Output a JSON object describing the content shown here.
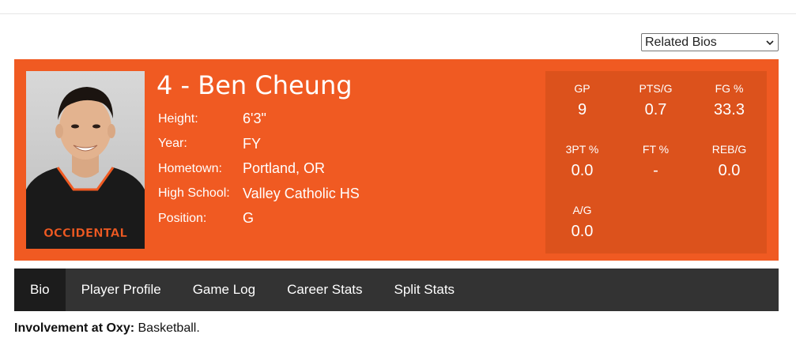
{
  "related_bios": {
    "selected": "Related Bios"
  },
  "player": {
    "title": "4 - Ben Cheung",
    "facts": [
      {
        "label": "Height:",
        "value": "6'3\""
      },
      {
        "label": "Year:",
        "value": "FY"
      },
      {
        "label": "Hometown:",
        "value": "Portland, OR"
      },
      {
        "label": "High School:",
        "value": "Valley Catholic HS"
      },
      {
        "label": "Position:",
        "value": "G"
      }
    ],
    "jersey_text": "OCCIDENTAL"
  },
  "stats": [
    {
      "label": "GP",
      "value": "9"
    },
    {
      "label": "PTS/G",
      "value": "0.7"
    },
    {
      "label": "FG %",
      "value": "33.3"
    },
    {
      "label": "3PT %",
      "value": "0.0"
    },
    {
      "label": "FT %",
      "value": "-"
    },
    {
      "label": "REB/G",
      "value": "0.0"
    },
    {
      "label": "A/G",
      "value": "0.0"
    }
  ],
  "tabs": [
    {
      "label": "Bio",
      "active": true
    },
    {
      "label": "Player Profile"
    },
    {
      "label": "Game Log"
    },
    {
      "label": "Career Stats"
    },
    {
      "label": "Split Stats"
    }
  ],
  "involvement": {
    "label": "Involvement at Oxy:",
    "value": "Basketball."
  },
  "colors": {
    "hero": "#f05a22",
    "stats_panel": "#dc521c",
    "tabs_bg": "#333333",
    "tab_active": "#1c1c1c"
  }
}
